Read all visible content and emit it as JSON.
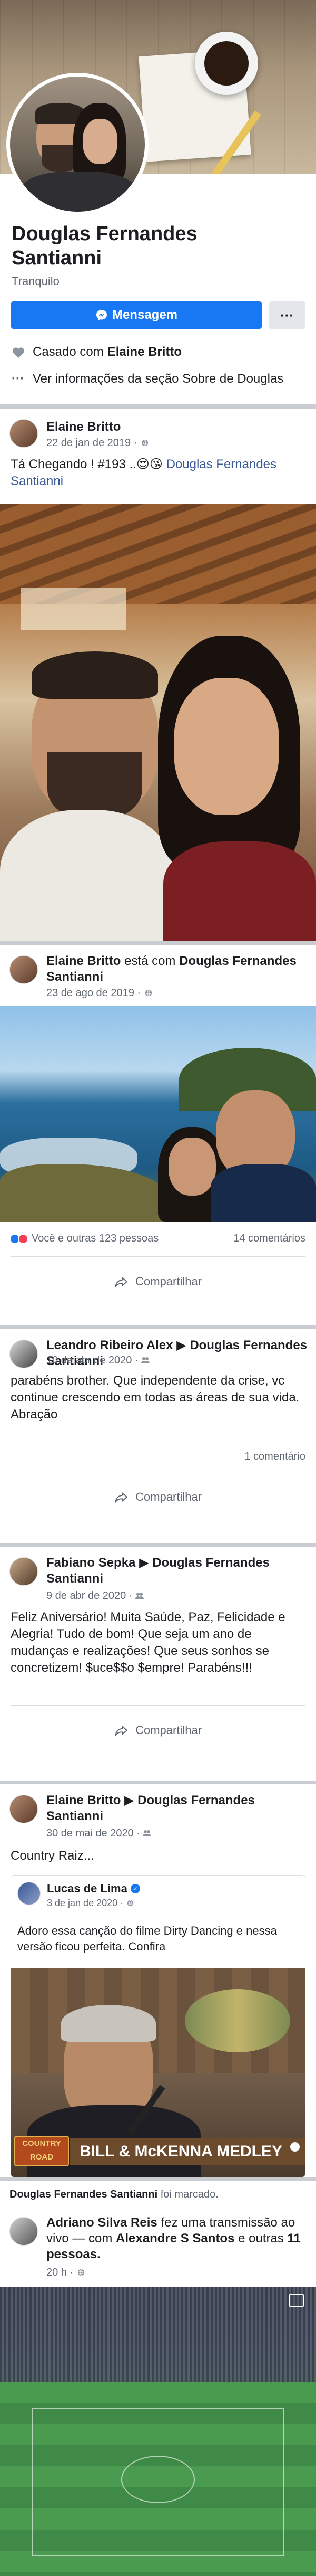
{
  "profile": {
    "name": "Douglas Fernandes Santianni",
    "status": "Tranquilo",
    "message_button": "Mensagem",
    "more_button": "···",
    "relationship_prefix": "Casado com",
    "relationship_partner": "Elaine Britto",
    "about_link": "Ver informações da seção Sobre de Douglas"
  },
  "posts": [
    {
      "author": "Elaine Britto",
      "date": "22 de jan de 2019 ·",
      "text_prefix": "Tá Chegando ! #193 ..",
      "emoji": "😍😘",
      "tag": "Douglas Fernandes Santianni"
    },
    {
      "author": "Elaine Britto",
      "connector": "está com",
      "with": "Douglas Fernandes Santianni",
      "date": "23 de ago de 2019 ·",
      "reactions": "Você e outras 123 pessoas",
      "comments": "14 comentários",
      "share": "Compartilhar"
    },
    {
      "author": "Leandro Ribeiro Alex",
      "target": "Douglas Fernandes Santianni",
      "date": "10 de abr de 2020 ·",
      "text": "parabéns brother. Que independente da crise, vc continue crescendo em todas as áreas de sua vida. Abração",
      "comments": "1 comentário",
      "share": "Compartilhar"
    },
    {
      "author": "Fabiano Sepka",
      "target": "Douglas Fernandes Santianni",
      "date": "9 de abr de 2020 ·",
      "text": "Feliz Aniversário! Muita Saúde, Paz, Felicidade e Alegria! Tudo de bom! Que seja um ano de mudanças e realizações! Que seus sonhos se concretizem! $uce$$o $empre! Parabéns!!!",
      "share": "Compartilhar"
    },
    {
      "author": "Elaine Britto",
      "target": "Douglas Fernandes Santianni",
      "date": "30 de mai de 2020 ·",
      "text": "Country Raiz...",
      "shared_author": "Lucas de Lima",
      "shared_date": "3 de jan de 2020 ·",
      "shared_text": "Adoro essa canção do filme Dirty Dancing e nessa versão ficou perfeita. Confira",
      "video_logo_top": "COUNTRY",
      "video_logo_bottom": "ROAD",
      "video_title": "BILL & McKENNA MEDLEY"
    },
    {
      "tagged_name": "Douglas Fernandes Santianni",
      "tagged_suffix": "foi marcado.",
      "author": "Adriano Silva Reis",
      "action": "fez uma transmissão ao vivo — com",
      "with1": "Alexandre S Santos",
      "and": "e outras",
      "with2": "11 pessoas.",
      "date": "20 h ·"
    }
  ],
  "colors": {
    "primary": "#1877f2",
    "link": "#385898",
    "muted": "#606770",
    "separator": "#c9ccd1"
  },
  "icons": [
    "messenger-icon",
    "heart-icon",
    "info-icon",
    "globe-icon",
    "share-icon",
    "like-reaction-icon",
    "love-reaction-icon",
    "verified-icon",
    "live-icon"
  ]
}
